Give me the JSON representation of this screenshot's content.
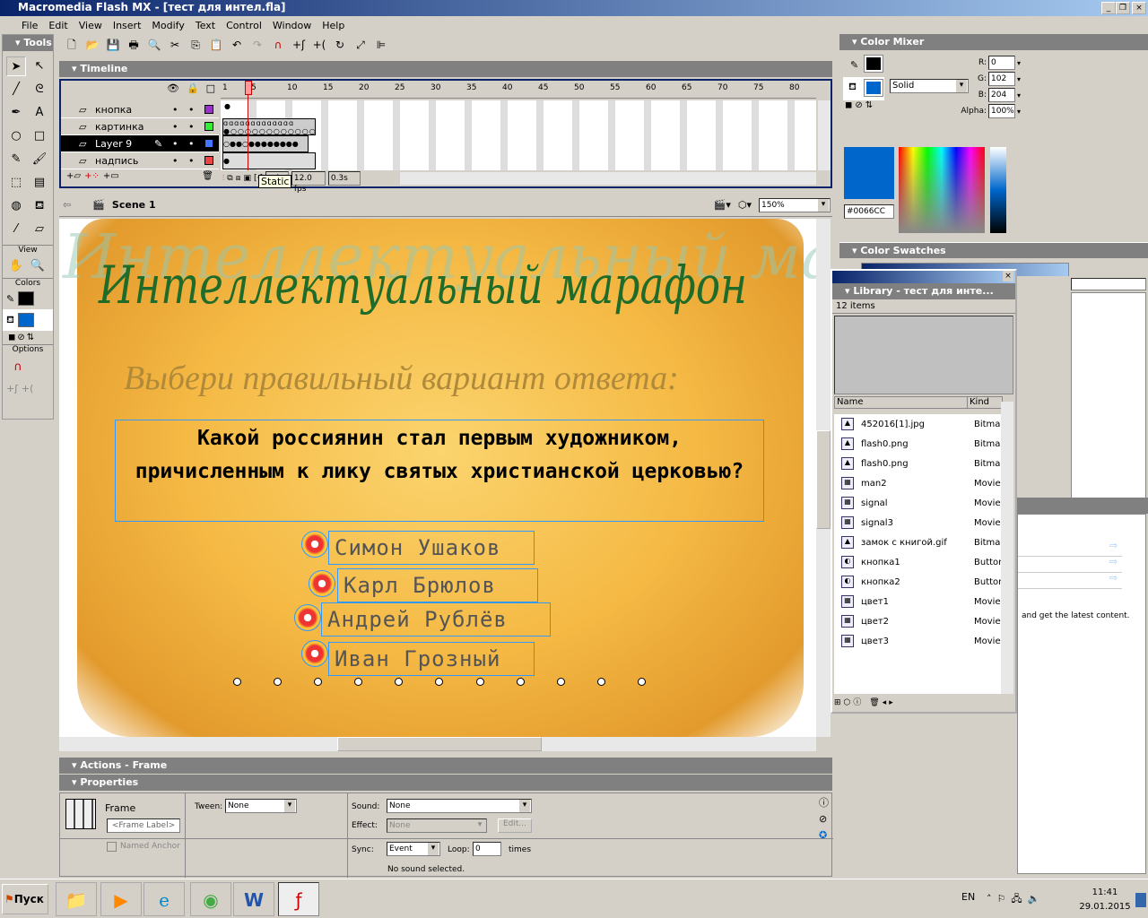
{
  "window": {
    "title": "Macromedia Flash MX - [тест для интел.fla]"
  },
  "menu": [
    "File",
    "Edit",
    "View",
    "Insert",
    "Modify",
    "Text",
    "Control",
    "Window",
    "Help"
  ],
  "tools": {
    "title": "Tools",
    "view_label": "View",
    "colors_label": "Colors",
    "options_label": "Options"
  },
  "timeline": {
    "title": "Timeline",
    "ruler": [
      "1",
      "5",
      "10",
      "15",
      "20",
      "25",
      "30",
      "35",
      "40",
      "45",
      "50",
      "55",
      "60",
      "65",
      "70",
      "75",
      "80"
    ],
    "layers": [
      {
        "name": "кнопка",
        "color": "#9933cc"
      },
      {
        "name": "картинка",
        "color": "#33ee33"
      },
      {
        "name": "Layer 9",
        "color": "#4477ff"
      },
      {
        "name": "надпись",
        "color": "#ee4444"
      }
    ],
    "tooltip": "Static",
    "current_frame": "4",
    "fps": "12.0 fps",
    "time": "0.3s"
  },
  "editbar": {
    "scene": "Scene 1",
    "zoom": "150%"
  },
  "stage": {
    "watermark": "Интеллектуальный марафон",
    "heading": "Интеллектуальный марафон",
    "subheading": "Выбери правильный вариант ответа:",
    "question": "Какой россиянин стал первым художником, причисленным к лику святых христианской церковью?",
    "answers": [
      "Симон  Ушаков",
      "Карл  Брюлов",
      "Андрей  Рублёв",
      "Иван  Грозный"
    ]
  },
  "actions": {
    "title": "Actions - Frame"
  },
  "properties": {
    "title": "Properties",
    "frame_label": "Frame",
    "frame_placeholder": "<Frame Label>",
    "tween_label": "Tween:",
    "tween": "None",
    "named_anchor": "Named Anchor",
    "sound_label": "Sound:",
    "sound": "None",
    "effect_label": "Effect:",
    "effect": "None",
    "edit_btn": "Edit...",
    "sync_label": "Sync:",
    "sync": "Event",
    "loop_label": "Loop:",
    "loop": "0",
    "times": "times",
    "status": "No sound selected."
  },
  "color_mixer": {
    "title": "Color Mixer",
    "fill_type": "Solid",
    "r_label": "R:",
    "r": "0",
    "g_label": "G:",
    "g": "102",
    "b_label": "B:",
    "b": "204",
    "alpha_label": "Alpha:",
    "alpha": "100%",
    "hex": "#0066CC",
    "fill_color": "#0066cc",
    "stroke_color": "#000000"
  },
  "color_swatches": {
    "title": "Color Swatches"
  },
  "library": {
    "title": "Library - тест для инте...",
    "count": "12 items",
    "col_name": "Name",
    "col_kind": "Kind",
    "items": [
      {
        "name": "452016[1].jpg",
        "kind": "Bitmap"
      },
      {
        "name": "flash0.png",
        "kind": "Bitmap"
      },
      {
        "name": "flash0.png",
        "kind": "Bitmap"
      },
      {
        "name": "man2",
        "kind": "Movie"
      },
      {
        "name": "signal",
        "kind": "Movie"
      },
      {
        "name": "signal3",
        "kind": "Movie"
      },
      {
        "name": "замок с книгой.gif",
        "kind": "Bitmap"
      },
      {
        "name": "кнопка1",
        "kind": "Button"
      },
      {
        "name": "кнопка2",
        "kind": "Button"
      },
      {
        "name": "цвет1",
        "kind": "Movie"
      },
      {
        "name": "цвет2",
        "kind": "Movie"
      },
      {
        "name": "цвет3",
        "kind": "Movie"
      }
    ]
  },
  "answers_panel": {
    "text": "and get the latest content."
  },
  "taskbar": {
    "start": "Пуск",
    "lang": "EN",
    "time": "11:41",
    "date": "29.01.2015"
  }
}
